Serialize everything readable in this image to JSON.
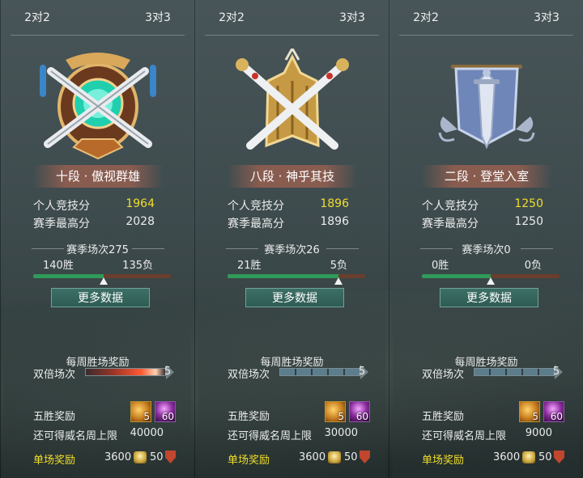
{
  "panels": [
    {
      "tab_left": "2对2",
      "tab_right": "3对3",
      "emblem": "jade-crossed-swords-emblem",
      "rank": "十段 · 傲视群雄",
      "personal_label": "个人竞技分",
      "personal_score": "1964",
      "season_high_label": "赛季最高分",
      "season_high": "2028",
      "season_matches": "赛季场次275",
      "wins": "140胜",
      "losses": "135负",
      "win_ratio": 0.509,
      "more_data": "更多数据",
      "weekly_title": "每周胜场奖励",
      "double_label": "双倍场次",
      "double_count": "5",
      "double_hot": true,
      "five_win_label": "五胜奖励",
      "reward_item1_count": "5",
      "reward_item2_count": "60",
      "limit_label": "还可得威名周上限",
      "limit_value": "40000",
      "single_label": "单场奖励",
      "single_coin": "3600",
      "single_shield": "50"
    },
    {
      "tab_left": "2对2",
      "tab_right": "3对3",
      "emblem": "gold-crossed-swords-emblem",
      "rank": "八段 · 神乎其技",
      "personal_label": "个人竞技分",
      "personal_score": "1896",
      "season_high_label": "赛季最高分",
      "season_high": "1896",
      "season_matches": "赛季场次26",
      "wins": "21胜",
      "losses": "5负",
      "win_ratio": 0.808,
      "more_data": "更多数据",
      "weekly_title": "每周胜场奖励",
      "double_label": "双倍场次",
      "double_count": "5",
      "double_hot": false,
      "five_win_label": "五胜奖励",
      "reward_item1_count": "5",
      "reward_item2_count": "60",
      "limit_label": "还可得威名周上限",
      "limit_value": "30000",
      "single_label": "单场奖励",
      "single_coin": "3600",
      "single_shield": "50"
    },
    {
      "tab_left": "2对2",
      "tab_right": "3对3",
      "emblem": "silver-banner-sword-emblem",
      "rank": "二段 · 登堂入室",
      "personal_label": "个人竞技分",
      "personal_score": "1250",
      "season_high_label": "赛季最高分",
      "season_high": "1250",
      "season_matches": "赛季场次0",
      "wins": "0胜",
      "losses": "0负",
      "win_ratio": 0.5,
      "more_data": "更多数据",
      "weekly_title": "每周胜场奖励",
      "double_label": "双倍场次",
      "double_count": "5",
      "double_hot": false,
      "five_win_label": "五胜奖励",
      "reward_item1_count": "5",
      "reward_item2_count": "60",
      "limit_label": "还可得威名周上限",
      "limit_value": "9000",
      "single_label": "单场奖励",
      "single_coin": "3600",
      "single_shield": "50"
    }
  ]
}
